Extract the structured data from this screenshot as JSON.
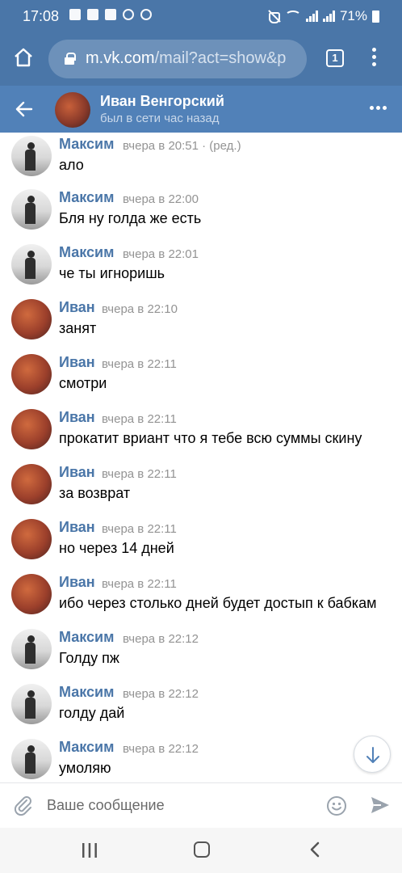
{
  "status_bar": {
    "time": "17:08",
    "battery": "71%",
    "icons": [
      "chat-icon",
      "check-icon",
      "image-icon",
      "settings-icon",
      "search-icon",
      "mute-icon",
      "wifi-icon",
      "signal-icon",
      "signal-icon",
      "battery-icon"
    ]
  },
  "browser": {
    "url_host": "m.vk.com",
    "url_path": "/mail?act=show&p",
    "tab_count": "1"
  },
  "header": {
    "name": "Иван Венгорский",
    "status": "был в сети час назад"
  },
  "messages": [
    {
      "author": "Максим",
      "time": "вчера в 20:51 · (ред.)",
      "text": "ало",
      "avatar": "maksim"
    },
    {
      "author": "Максим",
      "time": "вчера в 22:00",
      "text": "Бля ну голда же есть",
      "avatar": "maksim"
    },
    {
      "author": "Максим",
      "time": "вчера в 22:01",
      "text": "че ты игноришь",
      "avatar": "maksim"
    },
    {
      "author": "Иван",
      "time": "вчера в 22:10",
      "text": "занят",
      "avatar": "ivan"
    },
    {
      "author": "Иван",
      "time": "вчера в 22:11",
      "text": "смотри",
      "avatar": "ivan"
    },
    {
      "author": "Иван",
      "time": "вчера в 22:11",
      "text": "прокатит вриант что я тебе всю суммы скину",
      "avatar": "ivan"
    },
    {
      "author": "Иван",
      "time": "вчера в 22:11",
      "text": "за возврат",
      "avatar": "ivan"
    },
    {
      "author": "Иван",
      "time": "вчера в 22:11",
      "text": "но через 14 дней",
      "avatar": "ivan"
    },
    {
      "author": "Иван",
      "time": "вчера в 22:11",
      "text": "ибо через столько дней будет достып к бабкам",
      "avatar": "ivan"
    },
    {
      "author": "Максим",
      "time": "вчера в 22:12",
      "text": "Голду пж",
      "avatar": "maksim"
    },
    {
      "author": "Максим",
      "time": "вчера в 22:12",
      "text": "голду дай",
      "avatar": "maksim"
    },
    {
      "author": "Максим",
      "time": "вчера в 22:12",
      "text": "умоляю",
      "avatar": "maksim"
    }
  ],
  "composer": {
    "placeholder": "Ваше сообщение"
  },
  "colors": {
    "status_bar": "#4a76a8",
    "header": "#5181b8",
    "author": "#4a76a8",
    "time": "#939393"
  }
}
